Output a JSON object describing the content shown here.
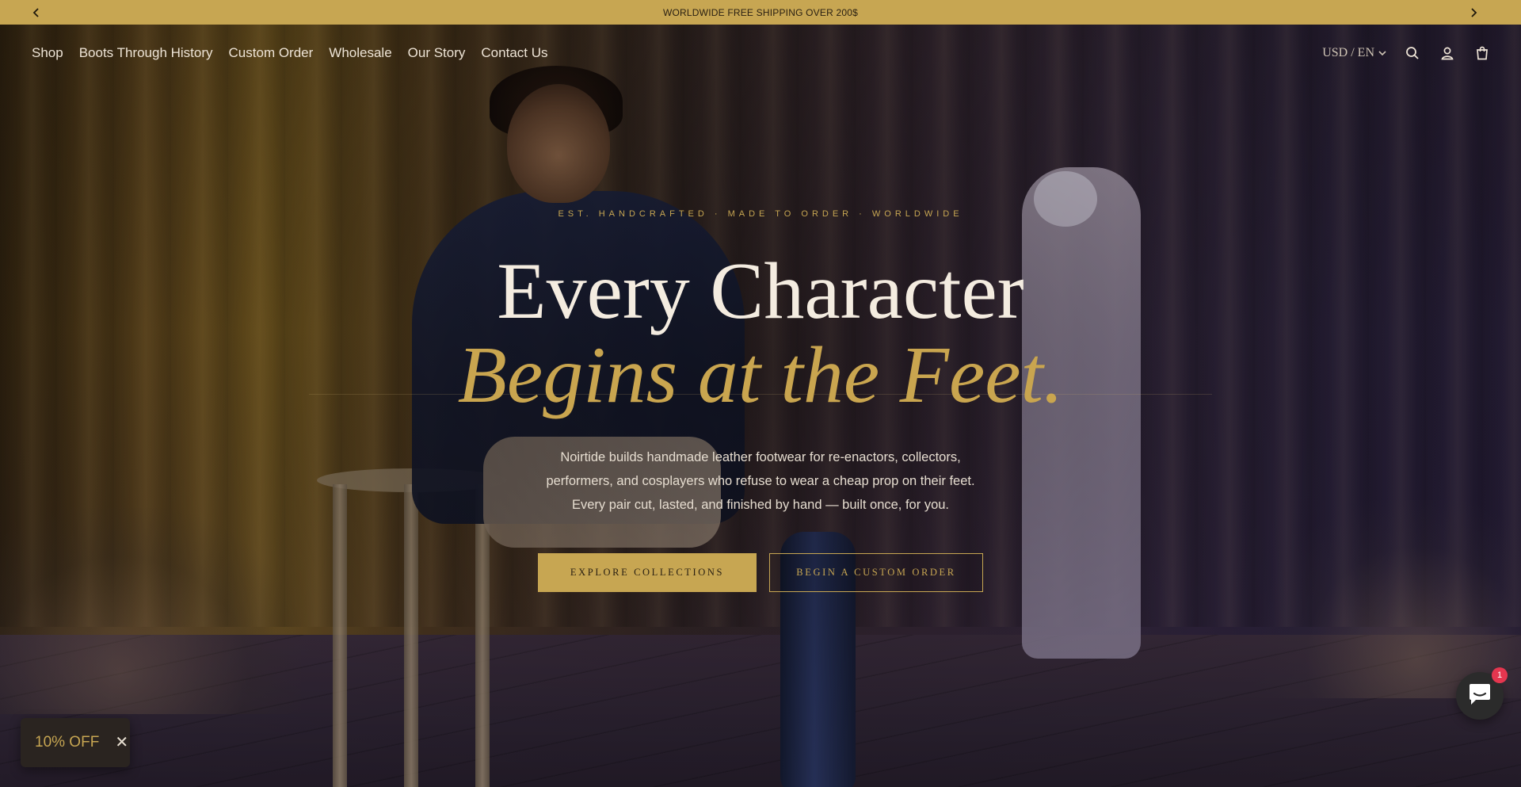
{
  "announcement": {
    "text": "WORLDWIDE FREE SHIPPING OVER 200$",
    "prev_icon": "chevron-left-icon",
    "next_icon": "chevron-right-icon"
  },
  "nav": {
    "items": [
      {
        "label": "Shop"
      },
      {
        "label": "Boots Through History"
      },
      {
        "label": "Custom Order"
      },
      {
        "label": "Wholesale"
      },
      {
        "label": "Our Story"
      },
      {
        "label": "Contact Us"
      }
    ]
  },
  "header": {
    "locale": "USD / EN",
    "icons": [
      "search-icon",
      "account-icon",
      "cart-icon"
    ]
  },
  "hero": {
    "eyebrow": "EST. HANDCRAFTED · MADE TO ORDER · WORLDWIDE",
    "headline_line1": "Every Character",
    "headline_line2": "Begins at the Feet.",
    "lead_line1": "Noirtide builds handmade leather footwear for re-enactors, collectors,",
    "lead_line2": "performers, and cosplayers who refuse to wear a cheap prop on their feet.",
    "lead_line3": "Every pair cut, lasted, and finished by hand — built once, for you.",
    "primary_button": "EXPLORE COLLECTIONS",
    "secondary_button": "BEGIN A CUSTOM ORDER"
  },
  "discount": {
    "label": "10% OFF",
    "close": "✕"
  },
  "chat": {
    "badge": "1"
  },
  "colors": {
    "accent": "#c7a652",
    "announcement_bg": "#c7a652",
    "headline": "#f4ece0",
    "badge": "#e5364f"
  }
}
